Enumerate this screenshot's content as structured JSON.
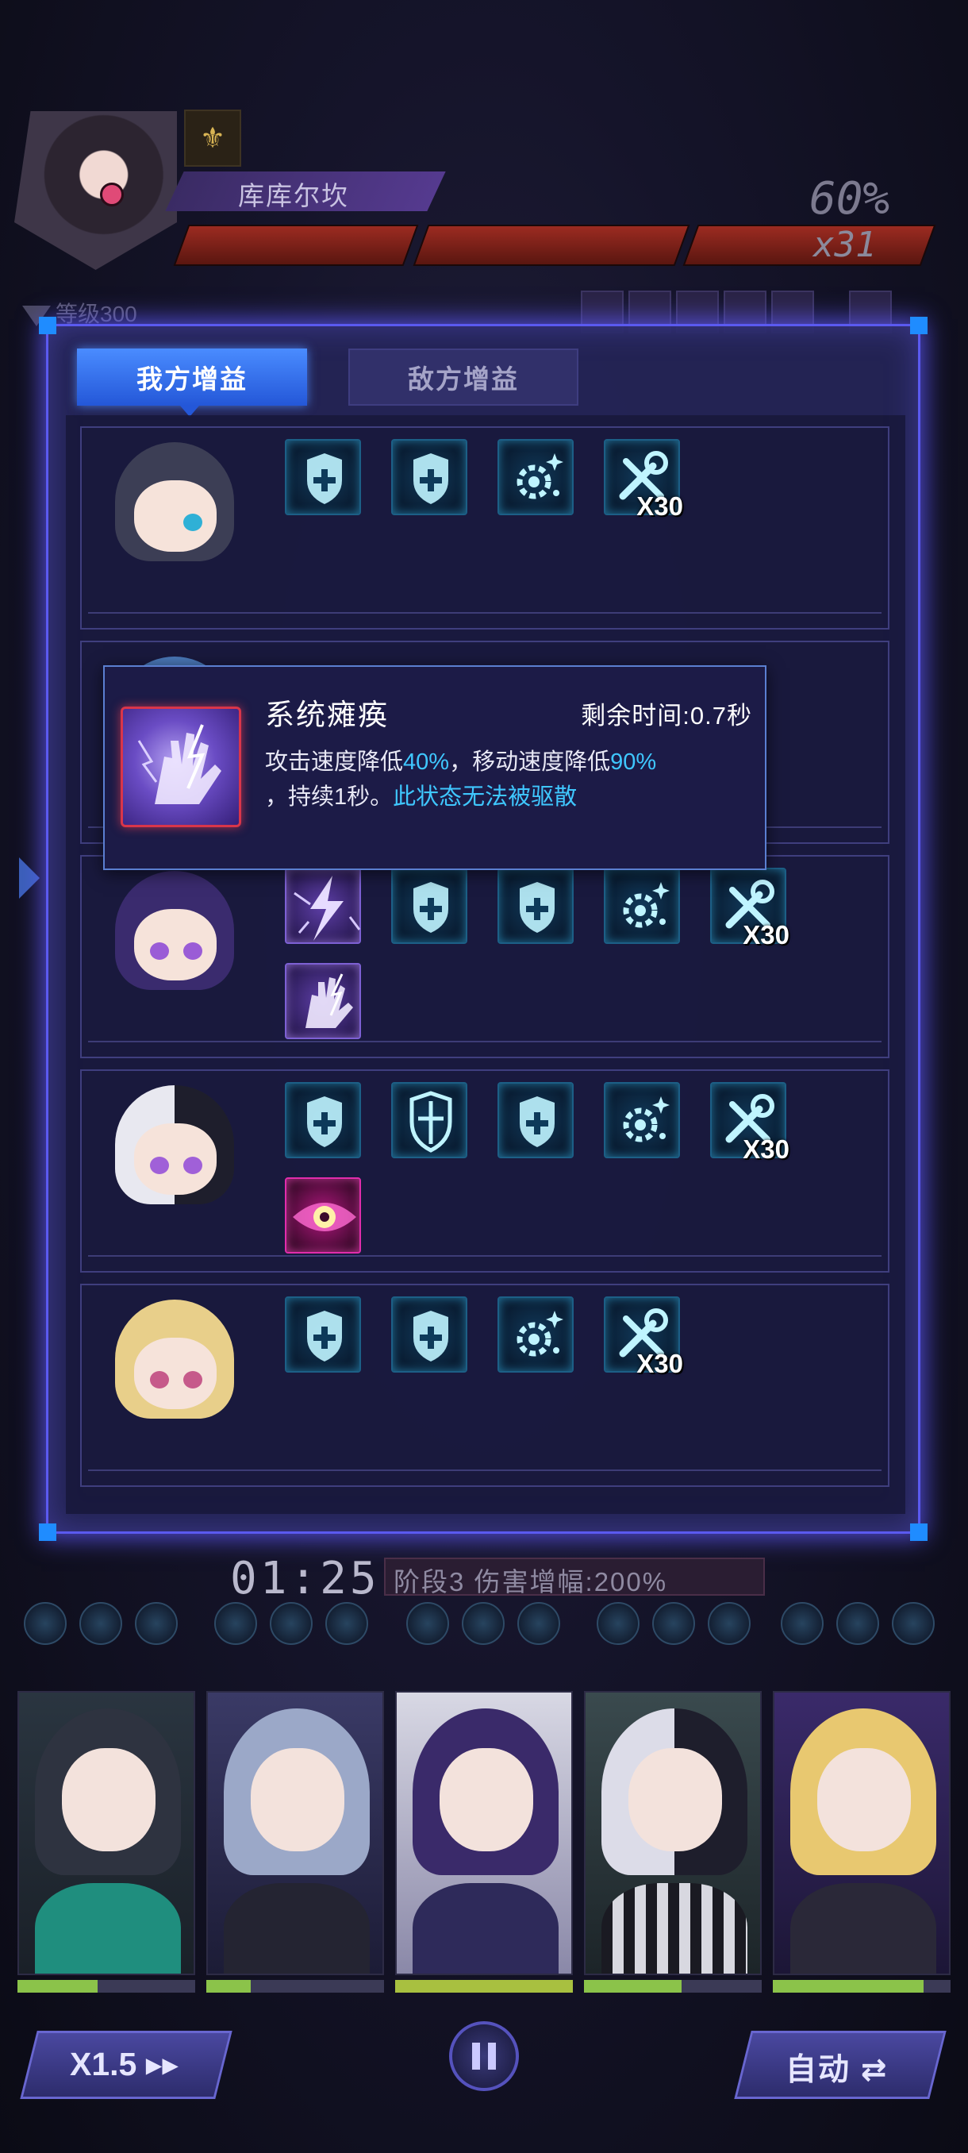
{
  "boss": {
    "name": "库库尔坎",
    "hp_percent": "60%",
    "hp_multiplier": "x31",
    "level": "等级300"
  },
  "buff_panel": {
    "tabs": [
      "我方增益",
      "敌方增益"
    ],
    "active_tab": "我方增益",
    "rows": [
      {
        "buffs": [
          {
            "icon": "shield-plus-icon"
          },
          {
            "icon": "shield-plus-icon"
          },
          {
            "icon": "gear-sparkle-icon"
          },
          {
            "icon": "wrench-icon",
            "count": "X30"
          }
        ]
      },
      {
        "buffs": []
      },
      {
        "buffs": [
          {
            "icon": "lightning-icon"
          },
          {
            "icon": "shield-plus-icon"
          },
          {
            "icon": "shield-plus-icon"
          },
          {
            "icon": "gear-sparkle-icon"
          },
          {
            "icon": "wrench-icon",
            "count": "X30"
          },
          {
            "icon": "shocked-hand-icon"
          }
        ]
      },
      {
        "buffs": [
          {
            "icon": "shield-plus-icon"
          },
          {
            "icon": "shield-cross-icon"
          },
          {
            "icon": "shield-plus-icon"
          },
          {
            "icon": "gear-sparkle-icon"
          },
          {
            "icon": "wrench-icon",
            "count": "X30"
          },
          {
            "icon": "eye-icon"
          }
        ]
      },
      {
        "buffs": [
          {
            "icon": "shield-plus-icon"
          },
          {
            "icon": "shield-plus-icon"
          },
          {
            "icon": "gear-sparkle-icon"
          },
          {
            "icon": "wrench-icon",
            "count": "X30"
          }
        ]
      }
    ]
  },
  "tooltip": {
    "title": "系统瘫痪",
    "remaining_label": "剩余时间:0.7秒",
    "desc_part1": "攻击速度降低",
    "desc_val1": "40%",
    "desc_part2": "，移动速度降低",
    "desc_val2": "90%",
    "desc_part3": "，持续1秒。",
    "desc_highlight": "此状态无法被驱散"
  },
  "stage": {
    "timer": "01:25",
    "info": "阶段3   伤害增幅:200%"
  },
  "controls": {
    "speed_label": "X1.5 ▸▸",
    "auto_label": "自动 ⇄"
  },
  "colors": {
    "accent": "#5b5af0",
    "highlight_text": "#3fc7ff",
    "tab_active": "#2457d8"
  }
}
